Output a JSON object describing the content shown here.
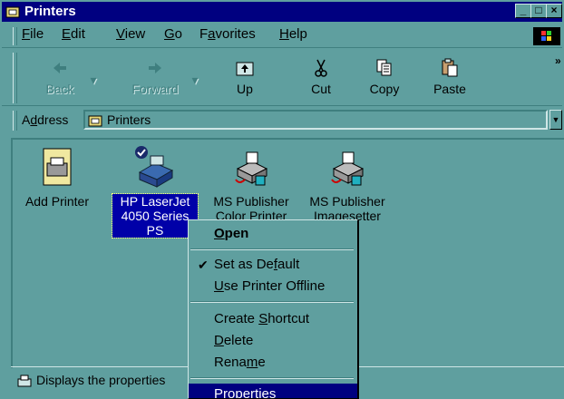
{
  "window": {
    "title": "Printers",
    "min": "_",
    "max": "□",
    "close": "×"
  },
  "menubar": {
    "items": [
      {
        "pre": "",
        "ul": "F",
        "post": "ile"
      },
      {
        "pre": "",
        "ul": "E",
        "post": "dit"
      },
      {
        "pre": "",
        "ul": "V",
        "post": "iew"
      },
      {
        "pre": "",
        "ul": "G",
        "post": "o"
      },
      {
        "pre": "F",
        "ul": "a",
        "post": "vorites"
      },
      {
        "pre": "",
        "ul": "H",
        "post": "elp"
      }
    ]
  },
  "toolbar": {
    "back": "Back",
    "forward": "Forward",
    "up": "Up",
    "cut": "Cut",
    "copy": "Copy",
    "paste": "Paste",
    "more": "»"
  },
  "address": {
    "label_pre": "A",
    "label_ul": "d",
    "label_post": "dress",
    "value": "Printers"
  },
  "items": [
    {
      "label": "Add Printer"
    },
    {
      "label": "HP LaserJet 4050 Series PS"
    },
    {
      "label": "MS Publisher Color Printer"
    },
    {
      "label": "MS Publisher Imagesetter"
    }
  ],
  "status": {
    "text": "Displays the properties"
  },
  "context_menu": {
    "open": {
      "ul": "O",
      "post": "pen"
    },
    "set_default": {
      "pre": "Set as De",
      "ul": "f",
      "post": "ault",
      "check": "✔"
    },
    "offline": {
      "pre": "",
      "ul": "U",
      "post": "se Printer Offline"
    },
    "shortcut": {
      "pre": "Create ",
      "ul": "S",
      "post": "hortcut"
    },
    "delete": {
      "pre": "",
      "ul": "D",
      "post": "elete"
    },
    "rename": {
      "pre": "Rena",
      "ul": "m",
      "post": "e"
    },
    "properties": {
      "pre": "P",
      "ul": "r",
      "post": "operties"
    }
  },
  "colors": {
    "face": "#5f9f9f",
    "title": "#000080",
    "selection": "#0000a8"
  }
}
